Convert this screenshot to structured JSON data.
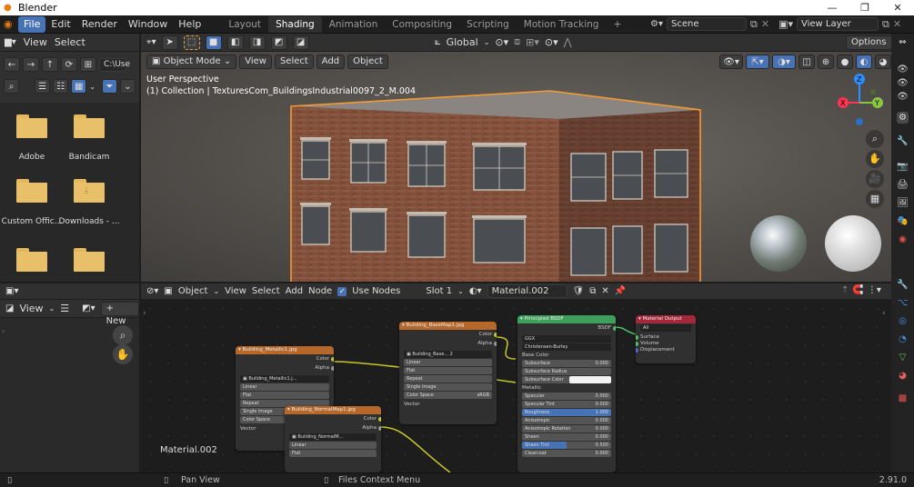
{
  "window": {
    "title": "Blender",
    "controls": [
      "—",
      "❐",
      "✕"
    ]
  },
  "menu": [
    "File",
    "Edit",
    "Render",
    "Window",
    "Help"
  ],
  "workspaces": [
    "Layout",
    "Shading",
    "Animation",
    "Compositing",
    "Scripting",
    "Motion Tracking"
  ],
  "scene": {
    "name": "Scene",
    "view_layer": "View Layer"
  },
  "file_browser": {
    "header": [
      "View",
      "Select"
    ],
    "path": "C:\\Use",
    "items": [
      {
        "name": "Adobe"
      },
      {
        "name": "Bandicam"
      },
      {
        "name": "Custom Offic..."
      },
      {
        "name": "Downloads - ..."
      },
      {
        "name": ""
      },
      {
        "name": ""
      }
    ]
  },
  "viewport": {
    "mode": "Object Mode",
    "menus": [
      "View",
      "Select",
      "Add",
      "Object"
    ],
    "transform": "Global",
    "options": "Options",
    "perspective": "User Perspective",
    "collection": "(1) Collection | TexturesCom_BuildingsIndustrial0097_2_M.004"
  },
  "image_editor": {
    "view": "View",
    "new": "New"
  },
  "node_editor": {
    "editor": "Object",
    "menus": [
      "View",
      "Select",
      "Add",
      "Node"
    ],
    "use_nodes": "Use Nodes",
    "slot": "Slot 1",
    "material": "Material.002",
    "label": "Material.002",
    "nodes": {
      "metallic": {
        "title": "Building_Metallic1.jpg",
        "outputs": [
          "Color",
          "Alpha"
        ],
        "image": "Building_Metallic1.j...",
        "fields": [
          "Linear",
          "Flat",
          "Repeat",
          "Single Image",
          "Color Space",
          "Vector"
        ]
      },
      "base": {
        "title": "Building_BaseMap1.jpg",
        "outputs": [
          "Color",
          "Alpha"
        ],
        "image": "Building_Base...",
        "count": "2",
        "fields": [
          "Linear",
          "Flat",
          "Repeat",
          "Single Image"
        ],
        "colorspace_label": "Color Space",
        "colorspace": "sRGB",
        "vector": "Vector"
      },
      "normal": {
        "title": "Building_NormalMap1.jpg",
        "outputs": [
          "Color",
          "Alpha"
        ],
        "image": "Building_NormalM...",
        "fields": [
          "Linear",
          "Flat"
        ]
      },
      "bsdf": {
        "title": "Principled BSDF",
        "output": "BSDF",
        "dist": "GGX",
        "sss": "Christensen-Burley",
        "inputs": [
          {
            "name": "Base Color",
            "value": ""
          },
          {
            "name": "Subsurface",
            "value": "0.000"
          },
          {
            "name": "Subsurface Radius",
            "value": ""
          },
          {
            "name": "Subsurface Color",
            "value": ""
          },
          {
            "name": "Metallic",
            "value": ""
          },
          {
            "name": "Specular",
            "value": "0.000"
          },
          {
            "name": "Specular Tint",
            "value": "0.000"
          },
          {
            "name": "Roughness",
            "value": "1.000"
          },
          {
            "name": "Anisotropic",
            "value": "0.000"
          },
          {
            "name": "Anisotropic Rotation",
            "value": "0.000"
          },
          {
            "name": "Sheen",
            "value": "0.000"
          },
          {
            "name": "Sheen Tint",
            "value": "0.500"
          },
          {
            "name": "Clearcoat",
            "value": "0.000"
          }
        ]
      },
      "output": {
        "title": "Material Output",
        "target": "All",
        "inputs": [
          "Surface",
          "Volume",
          "Displacement"
        ]
      }
    }
  },
  "status": {
    "pan": "Pan View",
    "context": "Files Context Menu",
    "version": "2.91.0"
  }
}
